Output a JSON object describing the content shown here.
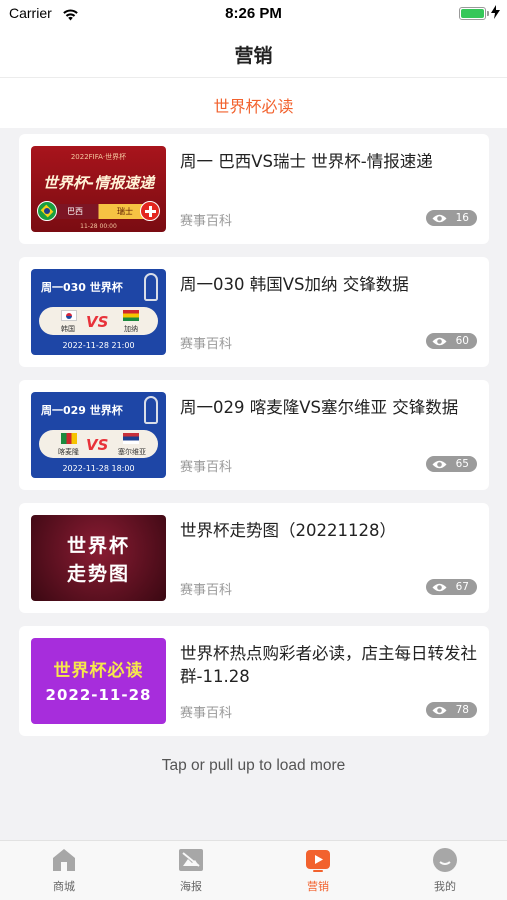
{
  "status_bar": {
    "carrier": "Carrier",
    "time": "8:26 PM",
    "battery_percent": 100,
    "icons": [
      "wifi-icon",
      "battery-icon",
      "charging-icon"
    ]
  },
  "header": {
    "title": "营销"
  },
  "category": {
    "active_tab": "世界杯必读",
    "accent_color": "#f2622e"
  },
  "articles": [
    {
      "title": "周一 巴西VS瑞士 世界杯-情报速递",
      "category": "赛事百科",
      "views": "16",
      "thumbnail": {
        "style": "red-banner",
        "headline": "世界杯-情报速递",
        "top_text": "2022FIFA·世界杯",
        "team_a": "巴西",
        "team_b": "瑞士",
        "match_time": "11-28 00:00"
      }
    },
    {
      "title": "周一030 韩国VS加纳 交锋数据",
      "category": "赛事百科",
      "views": "60",
      "thumbnail": {
        "style": "blue-match",
        "headline": "周一030 世界杯",
        "team_a": "韩国",
        "team_b": "加纳",
        "vs": "VS",
        "date": "2022-11-28  21:00"
      }
    },
    {
      "title": "周一029 喀麦隆VS塞尔维亚 交锋数据",
      "category": "赛事百科",
      "views": "65",
      "thumbnail": {
        "style": "blue-match",
        "headline": "周一029 世界杯",
        "team_a": "喀麦隆",
        "team_b": "塞尔维亚",
        "vs": "VS",
        "date": "2022-11-28  18:00"
      }
    },
    {
      "title": "世界杯走势图（20221128）",
      "category": "赛事百科",
      "views": "67",
      "thumbnail": {
        "style": "maroon-text",
        "line1": "世界杯",
        "line2": "走势图"
      }
    },
    {
      "title": "世界杯热点购彩者必读，店主每日转发社群-11.28",
      "category": "赛事百科",
      "views": "78",
      "thumbnail": {
        "style": "purple-text",
        "line1": "世界杯必读",
        "line2": "2022-11-28"
      }
    }
  ],
  "load_more": "Tap or pull up to load more",
  "tab_bar": [
    {
      "label": "商城",
      "icon": "store-icon",
      "active": false
    },
    {
      "label": "海报",
      "icon": "poster-icon",
      "active": false
    },
    {
      "label": "营销",
      "icon": "marketing-play-icon",
      "active": true
    },
    {
      "label": "我的",
      "icon": "profile-icon",
      "active": false
    }
  ]
}
